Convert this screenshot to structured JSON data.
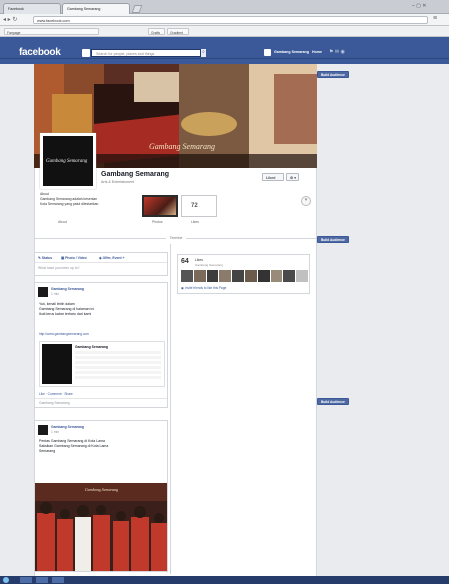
{
  "browser": {
    "tabs": [
      "Facebook",
      "Gambang Semarang"
    ],
    "url": "www.facebook.com",
    "bookmarks": [
      "Fanpage",
      "Grafis",
      "Gradient"
    ]
  },
  "facebook": {
    "logo": "facebook",
    "search_placeholder": "Search for people, places and things",
    "user_name": "Gambang Semarang",
    "home_label": "Home"
  },
  "page": {
    "name": "Gambang Semarang",
    "category": "Arts & Entertainment",
    "like_button": "Liked",
    "profile_text": "Gambang Semarang",
    "cover_text": "Gambang Semarang",
    "about_lines": [
      "About",
      "Gambang Semarang adalah kesenian",
      "Kota Semarang yang patut dilestarikan"
    ],
    "about_link": "About",
    "photos_label": "Photos",
    "likes_label": "Likes",
    "likes_count": "72",
    "promote_label": "Build Audience"
  },
  "timeline": {
    "divider": "Timeline",
    "composer": {
      "tabs": [
        "Status",
        "Photo / Video",
        "Offer, Event +"
      ],
      "placeholder": "What have you been up to?"
    },
    "likes_box": {
      "count": "64",
      "label": "Likes",
      "sub": "Gambang Semarang",
      "invite": "Invite friends to like this Page"
    },
    "posts": [
      {
        "author": "Gambang Semarang",
        "time": "1 min",
        "text_lines": [
          "Yuk, kenali lebih dalam",
          "Gambang Semarang di halaman ini",
          "Ikuti terus kabar terbaru dari kami"
        ],
        "link_url": "http://www.gambangsemarang.com",
        "link_title": "Gambang Semarang",
        "actions": "Like · Comment · Share",
        "footer": "Gambang Semarang"
      },
      {
        "author": "Gambang Semarang",
        "time": "1 min",
        "text_lines": [
          "Pentas Gambang Semarang di Kota Lama",
          "Saksikan Gambang Semarang di Kota Lama",
          "Semarang"
        ],
        "photo_caption": "Gambang Semarang"
      }
    ]
  },
  "right_buttons": [
    "Build Audience",
    "Build Audience",
    "Build Audience"
  ],
  "colors": {
    "fb_blue": "#3b5998",
    "page_bg": "#e9ebee",
    "accent_red": "#c0392b"
  }
}
